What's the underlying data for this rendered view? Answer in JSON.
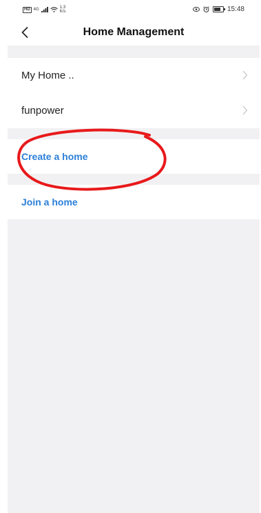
{
  "status_bar": {
    "hd": "HD",
    "signal": "4G",
    "speed_value": "1.3",
    "speed_unit": "K/s",
    "battery": "80",
    "time": "15:48",
    "icons": [
      "signal-icon",
      "wifi-icon",
      "eye-icon",
      "alarm-icon",
      "battery-icon"
    ]
  },
  "header": {
    "title": "Home Management",
    "back_icon": "chevron-left-icon"
  },
  "homes": [
    {
      "label": "My Home .."
    },
    {
      "label": "funpower"
    }
  ],
  "actions": {
    "create_label": "Create a home",
    "join_label": "Join a home"
  },
  "colors": {
    "accent": "#2b7fd8",
    "annotation": "#e8191b",
    "background": "#f1f1f3"
  }
}
